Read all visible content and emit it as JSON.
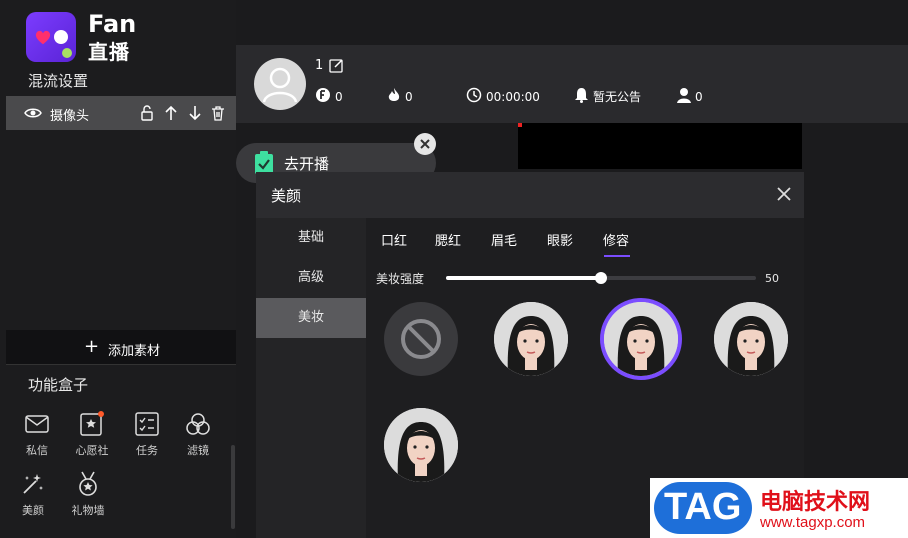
{
  "app": {
    "name_top": "Fan",
    "name_bottom": "直播"
  },
  "sidebar": {
    "mix_title": "混流设置",
    "source": {
      "label": "摄像头",
      "icons": [
        "eye-icon",
        "lock-icon",
        "arrow-up-icon",
        "arrow-down-icon",
        "trash-icon"
      ]
    },
    "add_material": "添加素材",
    "func_title": "功能盒子",
    "functions": [
      {
        "label": "私信",
        "icon": "mail-icon"
      },
      {
        "label": "心愿社",
        "icon": "wish-icon"
      },
      {
        "label": "任务",
        "icon": "task-icon"
      },
      {
        "label": "滤镜",
        "icon": "filter-icon"
      },
      {
        "label": "美颜",
        "icon": "beauty-wand-icon"
      },
      {
        "label": "礼物墙",
        "icon": "gift-medal-icon"
      }
    ]
  },
  "header": {
    "nickname": "1",
    "stats": [
      {
        "icon": "coin-icon",
        "value": "0"
      },
      {
        "icon": "fire-icon",
        "value": "0"
      },
      {
        "icon": "clock-icon",
        "value": "00:00:00"
      },
      {
        "icon": "bell-icon",
        "value": "暂无公告"
      },
      {
        "icon": "user-icon",
        "value": "0"
      }
    ]
  },
  "golive": {
    "label": "去开播"
  },
  "beauty": {
    "title": "美颜",
    "categories": [
      "基础",
      "高级",
      "美妆"
    ],
    "active_category": "美妆",
    "tabs": [
      "口红",
      "腮红",
      "眉毛",
      "眼影",
      "修容"
    ],
    "active_tab": "修容",
    "strength_label": "美妆强度",
    "strength_value": "50",
    "strength_fraction": 0.5,
    "selected_option": 2
  },
  "watermark": {
    "tag": "TAG",
    "cn": "电脑技术网",
    "url": "www.tagxp.com"
  },
  "colors": {
    "accent": "#7b4dff",
    "brand_start": "#7c3cff"
  }
}
